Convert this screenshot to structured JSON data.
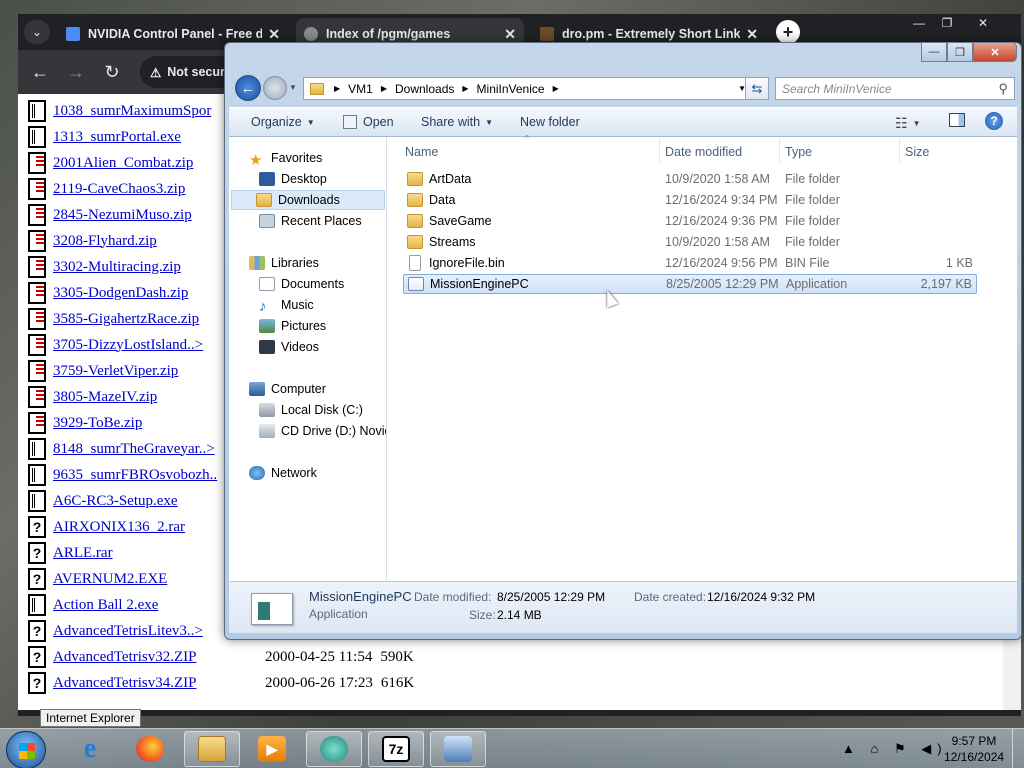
{
  "browser": {
    "tabs": [
      {
        "title": "NVIDIA Control Panel - Free download",
        "close": "✕",
        "favicon_color": "#4c8bf5"
      },
      {
        "title": "Index of /pgm/games",
        "close": "✕",
        "favicon_color": "#8a8a8a"
      },
      {
        "title": "dro.pm - Extremely Short Links",
        "close": "✕",
        "favicon_color": "#6a4b2a"
      }
    ],
    "tab_menu_icon": "chevron-down-icon",
    "new_tab_icon": "+",
    "window_buttons": {
      "minimize": "—",
      "maximize": "❐",
      "close": "✕"
    },
    "nav": {
      "back": "←",
      "forward": "→",
      "reload": "↻"
    },
    "security_label": "Not secure",
    "files": [
      {
        "name": "1038_sumrMaximumSpor",
        "icon": "exe"
      },
      {
        "name": "1313_sumrPortal.exe",
        "icon": "exe"
      },
      {
        "name": "2001Alien_Combat.zip",
        "icon": "zip"
      },
      {
        "name": "2119-CaveChaos3.zip",
        "icon": "zip"
      },
      {
        "name": "2845-NezumiMuso.zip",
        "icon": "zip"
      },
      {
        "name": "3208-Flyhard.zip",
        "icon": "zip"
      },
      {
        "name": "3302-Multiracing.zip",
        "icon": "zip"
      },
      {
        "name": "3305-DodgenDash.zip",
        "icon": "zip"
      },
      {
        "name": "3585-GigahertzRace.zip",
        "icon": "zip"
      },
      {
        "name": "3705-DizzyLostIsland..>",
        "icon": "zip"
      },
      {
        "name": "3759-VerletViper.zip",
        "icon": "zip"
      },
      {
        "name": "3805-MazeIV.zip",
        "icon": "zip"
      },
      {
        "name": "3929-ToBe.zip",
        "icon": "zip"
      },
      {
        "name": "8148_sumrTheGraveyar..>",
        "icon": "exe"
      },
      {
        "name": "9635_sumrFBROsvobozh..",
        "icon": "exe"
      },
      {
        "name": "A6C-RC3-Setup.exe",
        "icon": "exe"
      },
      {
        "name": "AIRXONIX136_2.rar",
        "icon": "unknown"
      },
      {
        "name": "ARLE.rar",
        "icon": "unknown"
      },
      {
        "name": "AVERNUM2.EXE",
        "icon": "unknown"
      },
      {
        "name": "Action Ball 2.exe",
        "icon": "exe"
      },
      {
        "name": "AdvancedTetrisLitev3..>",
        "icon": "unknown"
      },
      {
        "name": "AdvancedTetrisv32.ZIP",
        "icon": "unknown",
        "modified": "2000-04-25 11:54",
        "size": "590K"
      },
      {
        "name": "AdvancedTetrisv34.ZIP",
        "icon": "unknown",
        "modified": "2000-06-26 17:23",
        "size": "616K"
      }
    ],
    "tooltip": "Internet Explorer"
  },
  "explorer": {
    "window_buttons": {
      "minimize": "—",
      "maximize": "❐",
      "close": "✕"
    },
    "breadcrumb": [
      "VM1",
      "Downloads",
      "MiniInVenice"
    ],
    "search_placeholder": "Search MiniInVenice",
    "toolbar": {
      "organize": "Organize",
      "open": "Open",
      "share_with": "Share with",
      "new_folder": "New folder"
    },
    "nav": {
      "favorites": "Favorites",
      "favorites_items": [
        "Desktop",
        "Downloads",
        "Recent Places"
      ],
      "libraries": "Libraries",
      "libraries_items": [
        "Documents",
        "Music",
        "Pictures",
        "Videos"
      ],
      "computer": "Computer",
      "computer_items": [
        "Local Disk (C:)",
        "CD Drive (D:) Novide"
      ],
      "network": "Network"
    },
    "columns": {
      "name": "Name",
      "date": "Date modified",
      "type": "Type",
      "size": "Size"
    },
    "files": [
      {
        "name": "ArtData",
        "date": "10/9/2020 1:58 AM",
        "type": "File folder",
        "size": "",
        "icon": "folder"
      },
      {
        "name": "Data",
        "date": "12/16/2024 9:34 PM",
        "type": "File folder",
        "size": "",
        "icon": "folder"
      },
      {
        "name": "SaveGame",
        "date": "12/16/2024 9:36 PM",
        "type": "File folder",
        "size": "",
        "icon": "folder"
      },
      {
        "name": "Streams",
        "date": "10/9/2020 1:58 AM",
        "type": "File folder",
        "size": "",
        "icon": "folder"
      },
      {
        "name": "IgnoreFile.bin",
        "date": "12/16/2024 9:56 PM",
        "type": "BIN File",
        "size": "1 KB",
        "icon": "file"
      },
      {
        "name": "MissionEnginePC",
        "date": "8/25/2005 12:29 PM",
        "type": "Application",
        "size": "2,197 KB",
        "icon": "app",
        "selected": true
      }
    ],
    "details": {
      "name": "MissionEnginePC",
      "kind": "Application",
      "modified_label": "Date modified:",
      "modified": "8/25/2005 12:29 PM",
      "size_label": "Size:",
      "size": "2.14 MB",
      "created_label": "Date created:",
      "created": "12/16/2024 9:32 PM"
    }
  },
  "taskbar": {
    "apps": [
      "start-orb",
      "internet-explorer",
      "firefox",
      "windows-explorer",
      "media-player",
      "app-teal",
      "7zip",
      "network-tool"
    ],
    "seven_zip_label": "7z",
    "tray_icons": "▲ ⌂ ⚑ ◀)",
    "clock_time": "9:57 PM",
    "clock_date": "12/16/2024"
  },
  "colors": {
    "link": "#0000cc",
    "selection": "#cfe2f7",
    "chrome_dark": "#202124"
  }
}
